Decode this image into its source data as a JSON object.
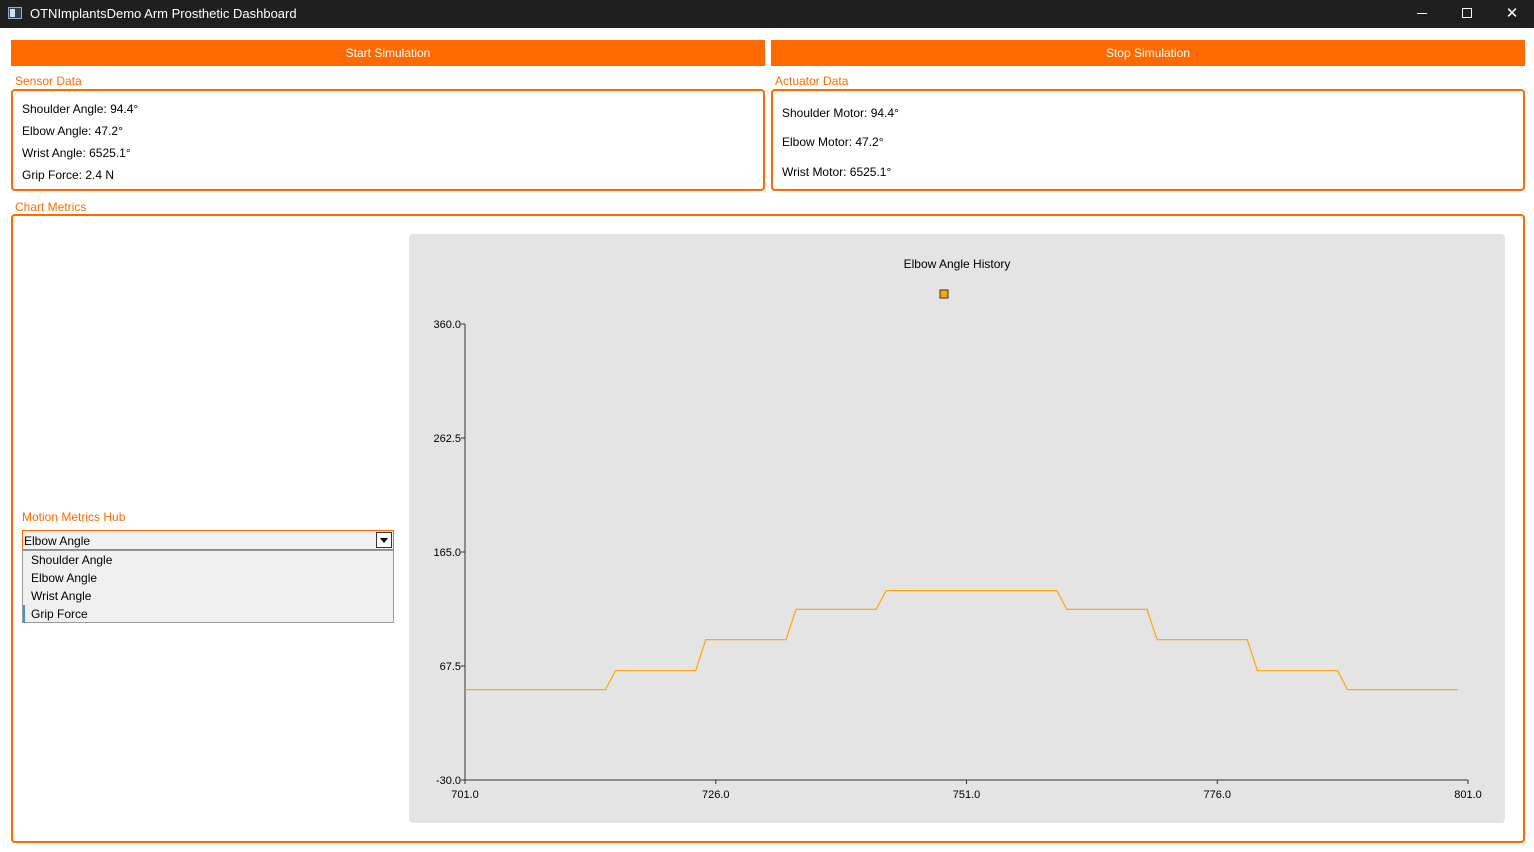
{
  "window": {
    "title": "OTNImplantsDemo Arm Prosthetic Dashboard",
    "minimize_glyph": "",
    "maximize_glyph": "",
    "close_glyph": "✕"
  },
  "controls": {
    "start_label": "Start Simulation",
    "stop_label": "Stop Simulation"
  },
  "sensor": {
    "group_label": "Sensor Data",
    "lines": [
      "Shoulder Angle: 94.4°",
      "Elbow Angle: 47.2°",
      "Wrist Angle: 6525.1°",
      "Grip Force: 2.4 N"
    ]
  },
  "actuator": {
    "group_label": "Actuator Data",
    "lines": [
      "Shoulder Motor: 94.4°",
      "Elbow Motor: 47.2°",
      "Wrist Motor: 6525.1°"
    ]
  },
  "metrics": {
    "group_label": "Chart Metrics",
    "combo_label": "Motion Metrics Hub",
    "selected": "Elbow Angle",
    "options": [
      "Shoulder Angle",
      "Elbow Angle",
      "Wrist Angle",
      "Grip Force"
    ]
  },
  "colors": {
    "accent": "#ff6a00",
    "series": "#ffa500",
    "panel_bg": "#e4e4e4",
    "titlebar_bg": "#1f1f1f"
  },
  "chart_data": {
    "type": "line",
    "title": "Elbow Angle History",
    "xlabel": "",
    "ylabel": "",
    "xlim": [
      701.0,
      801.0
    ],
    "ylim": [
      -30.0,
      360.0
    ],
    "x_ticks": [
      "701.0",
      "726.0",
      "751.0",
      "776.0",
      "801.0"
    ],
    "y_ticks": [
      "360.0",
      "262.5",
      "165.0",
      "67.5",
      "-30.0"
    ],
    "legend": "top-center",
    "grid": false,
    "series": [
      {
        "color": "#ffa500",
        "x": [
          701,
          715,
          716,
          724,
          725,
          733,
          734,
          742,
          743,
          760,
          761,
          769,
          770,
          779,
          780,
          788,
          789,
          800
        ],
        "y": [
          47.2,
          47.2,
          63.5,
          63.5,
          90.0,
          90.0,
          116.0,
          116.0,
          132.0,
          132.0,
          116.0,
          116.0,
          90.0,
          90.0,
          63.5,
          63.5,
          47.2,
          47.2
        ]
      }
    ]
  }
}
